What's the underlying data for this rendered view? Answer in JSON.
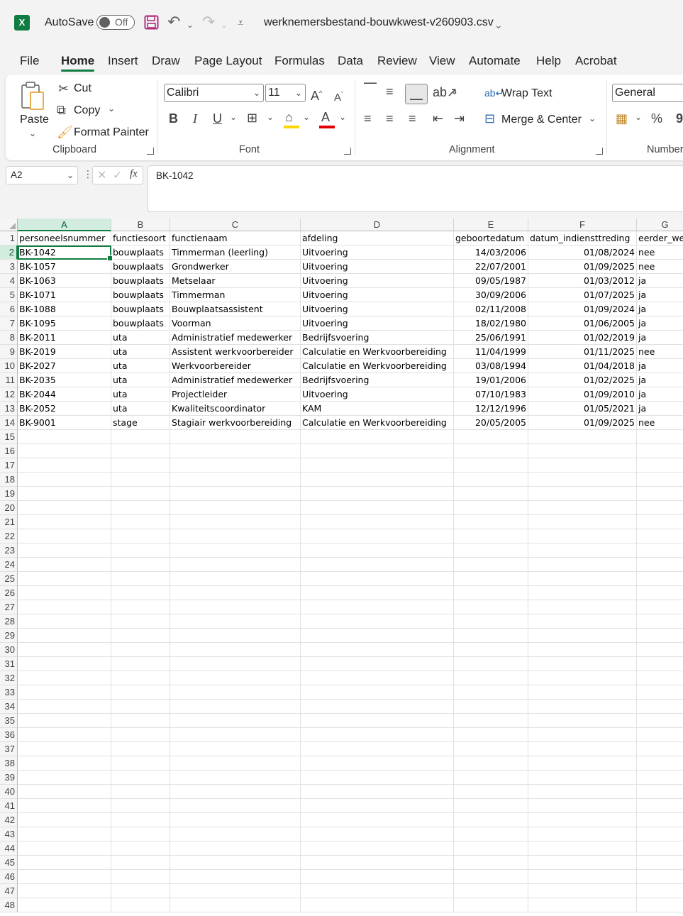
{
  "titlebar": {
    "autosave_label": "AutoSave",
    "autosave_state": "Off",
    "filename": "werknemersbestand-bouwkwest-v260903.csv"
  },
  "menu": [
    "File",
    "Home",
    "Insert",
    "Draw",
    "Page Layout",
    "Formulas",
    "Data",
    "Review",
    "View",
    "Automate",
    "Help",
    "Acrobat"
  ],
  "ribbon": {
    "clipboard": {
      "paste": "Paste",
      "cut": "Cut",
      "copy": "Copy",
      "format_painter": "Format Painter",
      "label": "Clipboard"
    },
    "font": {
      "name": "Calibri",
      "size": "11",
      "label": "Font",
      "fill_color": "#ffd700",
      "font_color": "#e00000"
    },
    "alignment": {
      "wrap_text": "Wrap Text",
      "merge_center": "Merge & Center",
      "label": "Alignment"
    },
    "number": {
      "format": "General",
      "label": "Number"
    }
  },
  "formula_bar": {
    "name_box": "A2",
    "content": "BK-1042"
  },
  "sheet": {
    "columns": [
      "A",
      "B",
      "C",
      "D",
      "E",
      "F",
      "G"
    ],
    "selected_column": "A",
    "selected_row": 2,
    "row_numbers": [
      "1",
      "2",
      "3",
      "4",
      "5",
      "6",
      "7",
      "8",
      "9",
      "10",
      "11",
      "12",
      "13",
      "14",
      "15",
      "16",
      "17",
      "18",
      "19",
      "20",
      "21",
      "22",
      "23",
      "24",
      "25",
      "26",
      "27",
      "28",
      "29",
      "30",
      "31",
      "32",
      "33",
      "34",
      "35",
      "36",
      "37",
      "38",
      "39",
      "40",
      "41",
      "42",
      "43",
      "44",
      "45",
      "46",
      "47",
      "48"
    ],
    "header": [
      "personeelsnummer",
      "functiesoort",
      "functienaam",
      "afdeling",
      "geboortedatum",
      "datum_indiensttreding",
      "eerder_we"
    ],
    "rows": [
      [
        "BK-1042",
        "bouwplaats",
        "Timmerman (leerling)",
        "Uitvoering",
        "14/03/2006",
        "01/08/2024",
        "nee"
      ],
      [
        "BK-1057",
        "bouwplaats",
        "Grondwerker",
        "Uitvoering",
        "22/07/2001",
        "01/09/2025",
        "nee"
      ],
      [
        "BK-1063",
        "bouwplaats",
        "Metselaar",
        "Uitvoering",
        "09/05/1987",
        "01/03/2012",
        "ja"
      ],
      [
        "BK-1071",
        "bouwplaats",
        "Timmerman",
        "Uitvoering",
        "30/09/2006",
        "01/07/2025",
        "ja"
      ],
      [
        "BK-1088",
        "bouwplaats",
        "Bouwplaatsassistent",
        "Uitvoering",
        "02/11/2008",
        "01/09/2024",
        "ja"
      ],
      [
        "BK-1095",
        "bouwplaats",
        "Voorman",
        "Uitvoering",
        "18/02/1980",
        "01/06/2005",
        "ja"
      ],
      [
        "BK-2011",
        "uta",
        "Administratief medewerker",
        "Bedrijfsvoering",
        "25/06/1991",
        "01/02/2019",
        "ja"
      ],
      [
        "BK-2019",
        "uta",
        "Assistent werkvoorbereider",
        "Calculatie en Werkvoorbereiding",
        "11/04/1999",
        "01/11/2025",
        "nee"
      ],
      [
        "BK-2027",
        "uta",
        "Werkvoorbereider",
        "Calculatie en Werkvoorbereiding",
        "03/08/1994",
        "01/04/2018",
        "ja"
      ],
      [
        "BK-2035",
        "uta",
        "Administratief medewerker",
        "Bedrijfsvoering",
        "19/01/2006",
        "01/02/2025",
        "ja"
      ],
      [
        "BK-2044",
        "uta",
        "Projectleider",
        "Uitvoering",
        "07/10/1983",
        "01/09/2010",
        "ja"
      ],
      [
        "BK-2052",
        "uta",
        "Kwaliteitscoordinator",
        "KAM",
        "12/12/1996",
        "01/05/2021",
        "ja"
      ],
      [
        "BK-9001",
        "stage",
        "Stagiair werkvoorbereiding",
        "Calculatie en Werkvoorbereiding",
        "20/05/2005",
        "01/09/2025",
        "nee"
      ]
    ]
  }
}
